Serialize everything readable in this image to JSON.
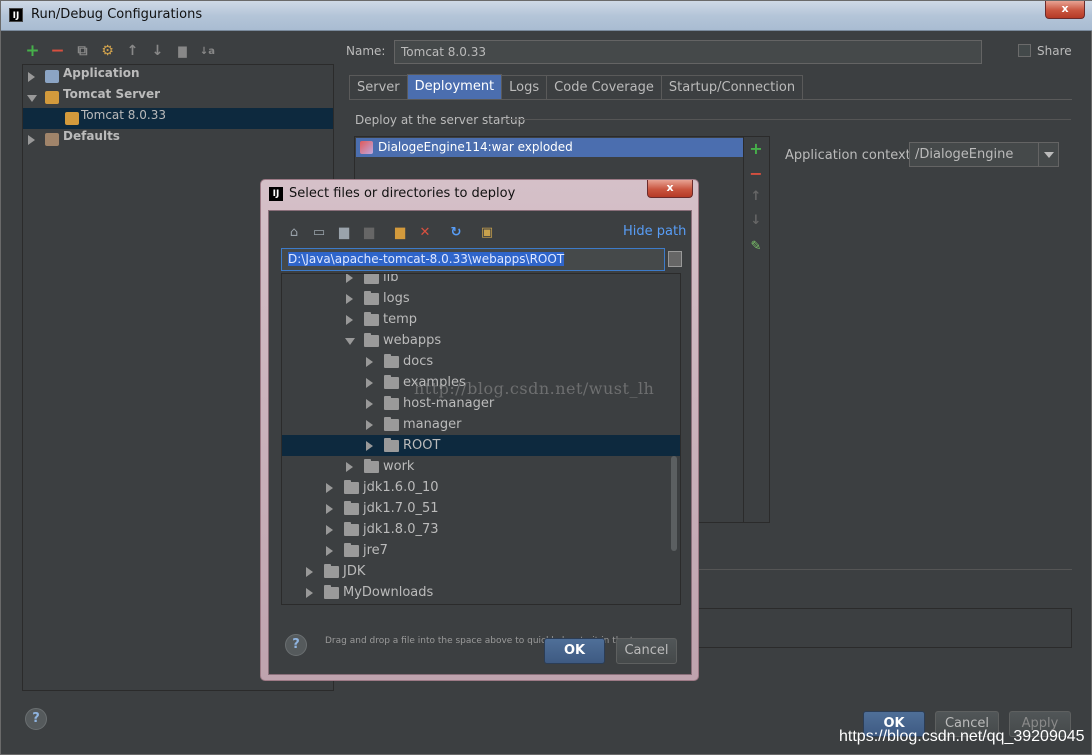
{
  "window": {
    "title": "Run/Debug Configurations",
    "close_label": "x",
    "app_icon_label": "IJ"
  },
  "left_toolbar": {
    "add": "+",
    "remove": "−",
    "copy": "⧉",
    "edit": "⚙",
    "up": "↑",
    "down": "↓",
    "folder": "▇",
    "sort": "↓a"
  },
  "config_tree": {
    "items": [
      {
        "label": "Application",
        "expanded": false
      },
      {
        "label": "Tomcat Server",
        "expanded": true
      },
      {
        "label": "Tomcat 8.0.33",
        "selected": true
      },
      {
        "label": "Defaults",
        "expanded": false
      }
    ]
  },
  "form": {
    "name_label": "Name:",
    "name_value": "Tomcat 8.0.33",
    "share_label": "Share",
    "tabs": [
      "Server",
      "Deployment",
      "Logs",
      "Code Coverage",
      "Startup/Connection"
    ],
    "active_tab": "Deployment",
    "deploy_label": "Deploy at the server startup",
    "deploy_items": [
      "DialogeEngine114:war exploded"
    ],
    "app_context_label": "Application context:",
    "app_context_value": "/DialogeEngine"
  },
  "bottom": {
    "ok": "OK",
    "cancel": "Cancel",
    "apply": "Apply",
    "help": "?"
  },
  "dialog": {
    "title": "Select files or directories to deploy",
    "close_label": "x",
    "hide_path": "Hide path",
    "path_value": "D:\\Java\\apache-tomcat-8.0.33\\webapps\\ROOT",
    "tree": [
      {
        "label": "lib",
        "level": 3,
        "expanded": false
      },
      {
        "label": "logs",
        "level": 3,
        "expanded": false
      },
      {
        "label": "temp",
        "level": 3,
        "expanded": false
      },
      {
        "label": "webapps",
        "level": 3,
        "expanded": true
      },
      {
        "label": "docs",
        "level": 4,
        "expanded": false
      },
      {
        "label": "examples",
        "level": 4,
        "expanded": false
      },
      {
        "label": "host-manager",
        "level": 4,
        "expanded": false
      },
      {
        "label": "manager",
        "level": 4,
        "expanded": false
      },
      {
        "label": "ROOT",
        "level": 4,
        "expanded": false,
        "selected": true
      },
      {
        "label": "work",
        "level": 3,
        "expanded": false
      },
      {
        "label": "jdk1.6.0_10",
        "level": 2,
        "expanded": false
      },
      {
        "label": "jdk1.7.0_51",
        "level": 2,
        "expanded": false
      },
      {
        "label": "jdk1.8.0_73",
        "level": 2,
        "expanded": false
      },
      {
        "label": "jre7",
        "level": 2,
        "expanded": false
      },
      {
        "label": "JDK",
        "level": 1,
        "expanded": false
      },
      {
        "label": "MyDownloads",
        "level": 1,
        "expanded": false
      }
    ],
    "drag_hint": "Drag and drop a file into the space above to quickly locate it in the tree",
    "ok": "OK",
    "cancel": "Cancel",
    "help": "?"
  },
  "watermarks": {
    "center": "http://blog.csdn.net/wust_lh",
    "corner": "https://blog.csdn.net/qq_39209045"
  },
  "colors": {
    "accent": "#4b6eaf",
    "selection": "#0d293e",
    "add": "#46b04a",
    "remove": "#d8503f"
  }
}
